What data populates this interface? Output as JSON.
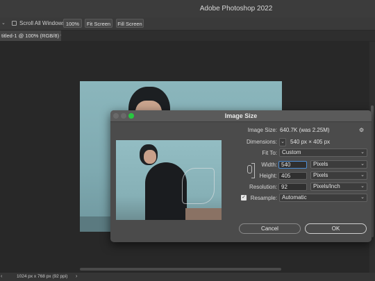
{
  "app": {
    "window_title": "Adobe Photoshop 2022"
  },
  "options_bar": {
    "scroll_all_windows_label": "Scroll All Windows",
    "zoom_100_label": "100%",
    "fit_screen_label": "Fit Screen",
    "fill_screen_label": "Fill Screen"
  },
  "document_tab": {
    "label": "titled-1 @ 100% (RGB/8) *"
  },
  "status_bar": {
    "doc_info": "1024 px x 768 px (92 ppi)"
  },
  "dialog": {
    "title": "Image Size",
    "image_size_label": "Image Size:",
    "image_size_value": "640.7K (was 2.25M)",
    "dimensions_label": "Dimensions:",
    "dimensions_value": "540 px  ×  405 px",
    "fit_to_label": "Fit To:",
    "fit_to_value": "Custom",
    "width_label": "Width:",
    "width_value": "540",
    "width_unit": "Pixels",
    "height_label": "Height:",
    "height_value": "405",
    "height_unit": "Pixels",
    "resolution_label": "Resolution:",
    "resolution_value": "92",
    "resolution_unit": "Pixels/Inch",
    "resample_label": "Resample:",
    "resample_value": "Automatic",
    "resample_checked": true,
    "cancel_label": "Cancel",
    "ok_label": "OK"
  },
  "colors": {
    "close": "#fe5f57",
    "minimize": "#febc2e",
    "zoom": "#28c840",
    "focus_border": "#4e8fd6"
  }
}
